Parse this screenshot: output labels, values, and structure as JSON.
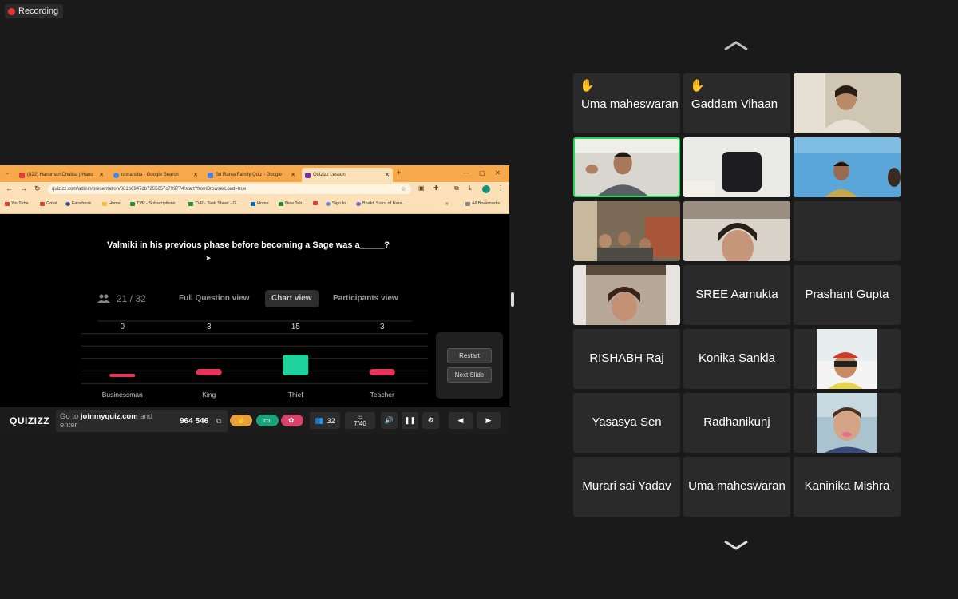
{
  "recording": {
    "label": "Recording"
  },
  "browser": {
    "tabs": [
      {
        "label": "(822) Hanuman Chalisa | Hanu",
        "color": "#e23b3b"
      },
      {
        "label": "rama sitta - Google Search",
        "color": "#4285f4"
      },
      {
        "label": "Sri Rama Family Quiz - Google",
        "color": "#4a7ee8"
      },
      {
        "label": "Quizizz Lesson",
        "color": "#7a2ea0"
      }
    ],
    "new_tab": "+",
    "url": "quizizz.com/admin/presentation/661b6947db7255657c799774/start?fromBrowserLoad=true",
    "bookmarks": [
      {
        "label": "YouTube",
        "color": "#e23b3b"
      },
      {
        "label": "Gmail",
        "color": "#d44638"
      },
      {
        "label": "Facebook",
        "color": "#3b5998"
      },
      {
        "label": "Home",
        "color": "#f0c040"
      },
      {
        "label": "TVP - Subscriptions...",
        "color": "#1f8f4a"
      },
      {
        "label": "TVP - Task Sheet - G...",
        "color": "#1f8f4a"
      },
      {
        "label": "Home",
        "color": "#0a66c2"
      },
      {
        "label": "New Tab",
        "color": "#1f8f4a"
      },
      {
        "label": "Sign In",
        "color": "#6b8fcf"
      },
      {
        "label": "Bhakti Sutra of Nara...",
        "color": "#6b6bd0"
      }
    ],
    "all_bookmarks": "All Bookmarks"
  },
  "quiz": {
    "question": "Valmiki in his previous phase before becoming a Sage was a_____?",
    "participants": "21 / 32",
    "views": [
      "Full Question view",
      "Chart view",
      "Participants view"
    ],
    "selected_view": "Chart view",
    "restart": "Restart",
    "next_slide": "Next Slide"
  },
  "chart_data": {
    "type": "bar",
    "categories": [
      "Businessman",
      "King",
      "Thief",
      "Teacher"
    ],
    "values": [
      0,
      3,
      15,
      3
    ],
    "ylim": [
      0,
      15
    ],
    "colors": [
      "#e8345a",
      "#e8345a",
      "#1fd19a",
      "#e8345a"
    ]
  },
  "quizbar": {
    "logo": "QUIZIZZ",
    "join_prefix": "Go to ",
    "join_site": "joinmyquiz.com",
    "join_suffix": " and enter",
    "code": "964 546",
    "players": "32",
    "slide": "7/40"
  },
  "gallery": {
    "tiles": [
      {
        "name": "Uma maheswaran",
        "hand": true
      },
      {
        "name": "Gaddam Vihaan",
        "hand": true
      },
      {
        "name": "",
        "video": "woman"
      },
      {
        "name": "",
        "video": "man",
        "active": true
      },
      {
        "name": "",
        "video": "room"
      },
      {
        "name": "",
        "video": "boy"
      },
      {
        "name": "",
        "video": "family"
      },
      {
        "name": "",
        "video": "girl"
      },
      {
        "name": ""
      },
      {
        "name": "",
        "video": "girl2"
      },
      {
        "name": "SREE Aamukta"
      },
      {
        "name": "Prashant Gupta"
      },
      {
        "name": "RISHABH Raj"
      },
      {
        "name": "Konika Sankla"
      },
      {
        "name": "",
        "avatar": "cartoon-boy"
      },
      {
        "name": "Yasasya Sen"
      },
      {
        "name": "Radhanikunj"
      },
      {
        "name": "",
        "avatar": "photo-boy"
      },
      {
        "name": "Murari sai Yadav"
      },
      {
        "name": "Uma maheswaran"
      },
      {
        "name": "Kaninika Mishra"
      }
    ]
  }
}
